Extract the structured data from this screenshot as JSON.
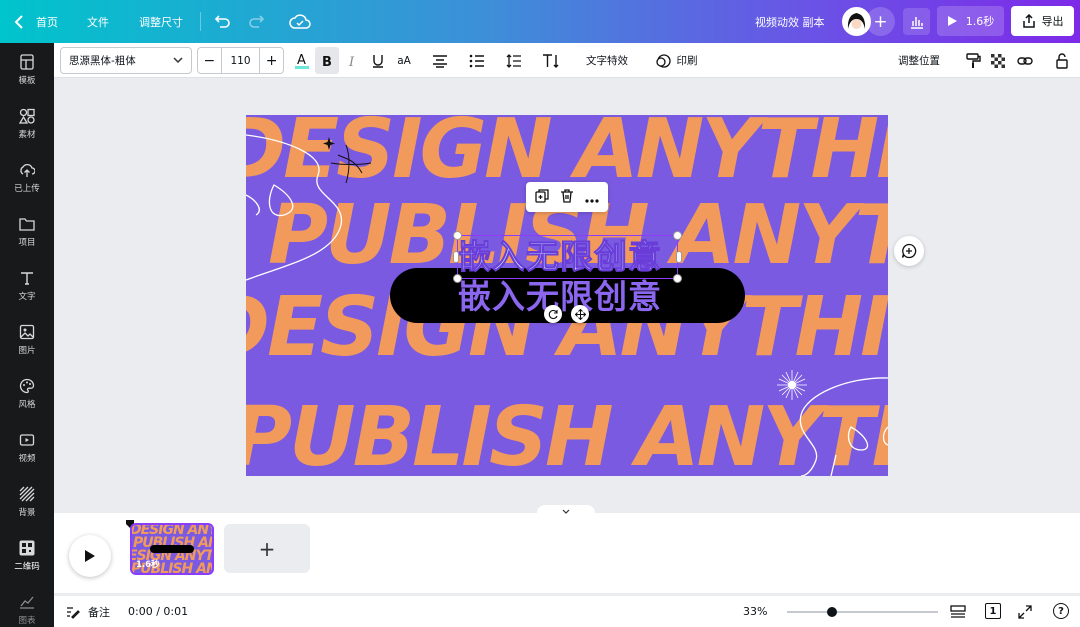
{
  "topbar": {
    "home_label": "首页",
    "file_label": "文件",
    "resize_label": "调整尺寸",
    "doc_title": "视频动效 副本",
    "play_duration": "1.6秒",
    "export_label": "导出"
  },
  "format_toolbar": {
    "font_name": "思源黑体-粗体",
    "font_size": "110",
    "minus": "−",
    "plus": "+",
    "case_label": "aA",
    "effects_label": "文字特效",
    "print_label": "印刷",
    "position_label": "调整位置"
  },
  "sidebar": {
    "items": [
      {
        "label": "模板",
        "icon": "template-icon"
      },
      {
        "label": "素材",
        "icon": "elements-icon"
      },
      {
        "label": "已上传",
        "icon": "upload-icon"
      },
      {
        "label": "项目",
        "icon": "folder-icon"
      },
      {
        "label": "文字",
        "icon": "text-icon"
      },
      {
        "label": "图片",
        "icon": "photo-icon"
      },
      {
        "label": "风格",
        "icon": "palette-icon"
      },
      {
        "label": "视频",
        "icon": "video-icon"
      },
      {
        "label": "背景",
        "icon": "background-icon"
      },
      {
        "label": "二维码",
        "icon": "qrcode-icon"
      },
      {
        "label": "图表",
        "icon": "chart-icon"
      }
    ]
  },
  "canvas": {
    "rows": [
      "DESIGN ANYTHING",
      "PUBLISH ANYTHING",
      "DESIGN ANYTHING",
      "PUBLISH ANYTHING"
    ],
    "headline": "嵌入无限创意",
    "subline": "嵌入无限创意",
    "colors": {
      "background": "#7a5ae0",
      "text": "#f29a5c",
      "pill": "#000000"
    }
  },
  "timeline": {
    "thumb_rows": [
      "DESIGN ANY",
      "PUBLISH AN",
      "ESIGN ANYT",
      "PUBLISH ANY"
    ],
    "thumb_duration": "1.6秒",
    "add_label": "+"
  },
  "footer": {
    "notes_label": "备注",
    "time": "0:00 / 0:01",
    "zoom": "33%",
    "page_number": "1",
    "help": "?"
  }
}
